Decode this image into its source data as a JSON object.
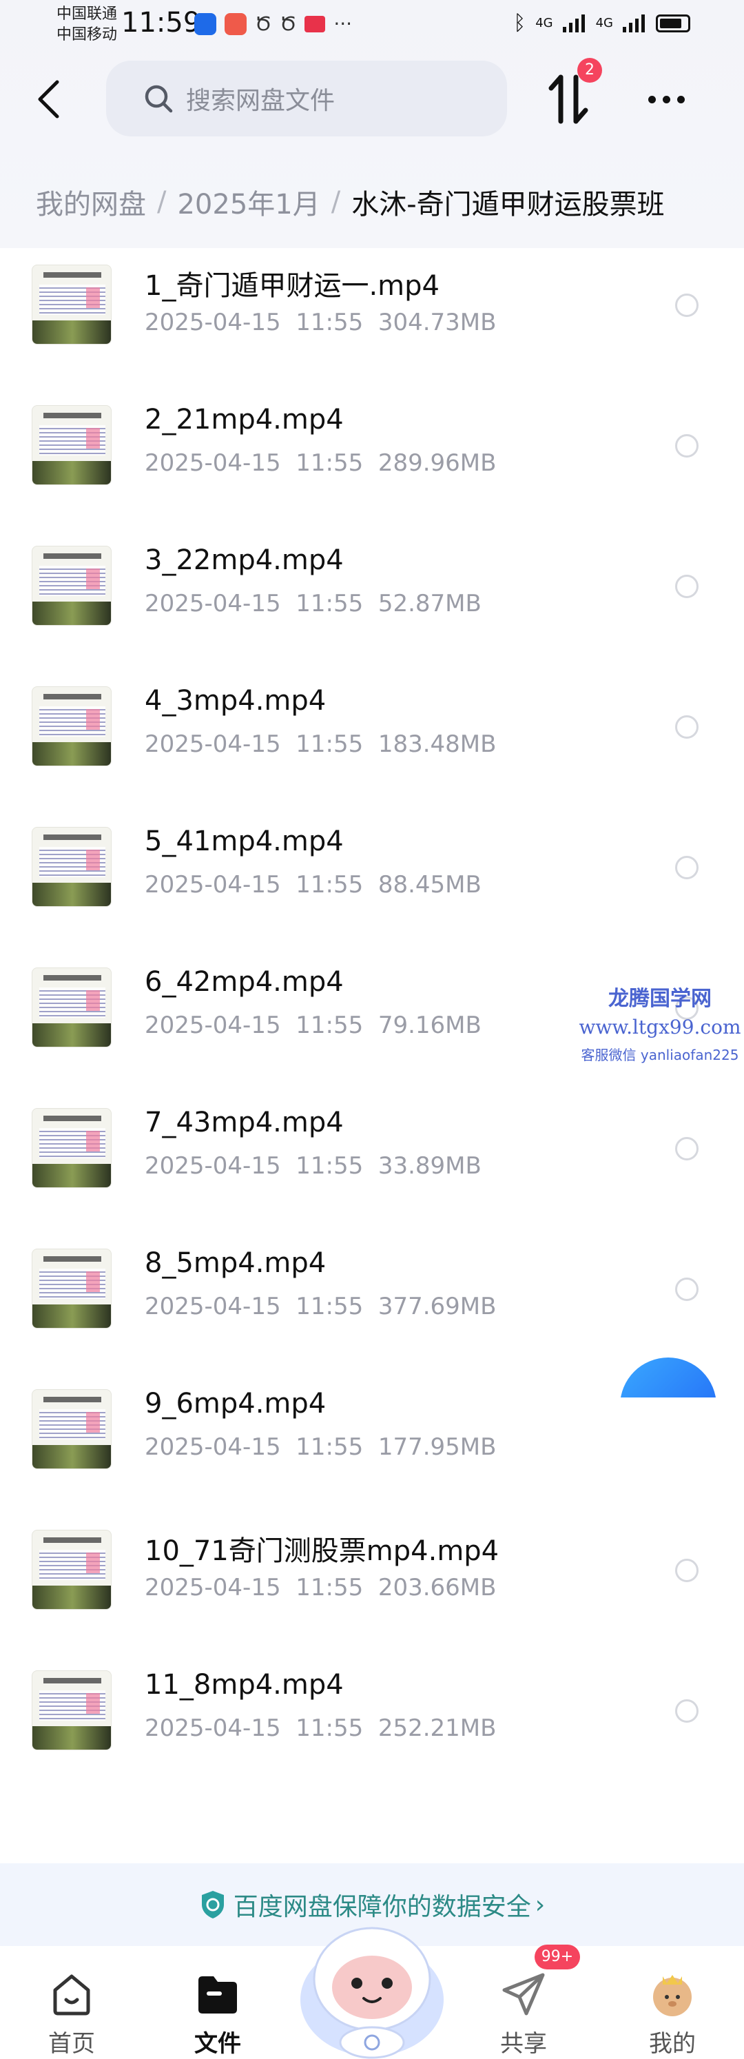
{
  "status_bar": {
    "carrier_1": "中国联通",
    "carrier_2": "中国移动",
    "time": "11:59",
    "net_1": "4G",
    "net_2": "4G"
  },
  "header": {
    "search_placeholder": "搜索网盘文件",
    "transfer_badge": "2"
  },
  "breadcrumb": {
    "root": "我的网盘",
    "middle": "2025年1月",
    "current": "水沐-奇门遁甲财运股票班"
  },
  "files": [
    {
      "name": "1_奇门遁甲财运一.mp4",
      "date": "2025-04-15",
      "time": "11:55",
      "size": "304.73MB"
    },
    {
      "name": "2_21mp4.mp4",
      "date": "2025-04-15",
      "time": "11:55",
      "size": "289.96MB"
    },
    {
      "name": "3_22mp4.mp4",
      "date": "2025-04-15",
      "time": "11:55",
      "size": "52.87MB"
    },
    {
      "name": "4_3mp4.mp4",
      "date": "2025-04-15",
      "time": "11:55",
      "size": "183.48MB"
    },
    {
      "name": "5_41mp4.mp4",
      "date": "2025-04-15",
      "time": "11:55",
      "size": "88.45MB"
    },
    {
      "name": "6_42mp4.mp4",
      "date": "2025-04-15",
      "time": "11:55",
      "size": "79.16MB"
    },
    {
      "name": "7_43mp4.mp4",
      "date": "2025-04-15",
      "time": "11:55",
      "size": "33.89MB"
    },
    {
      "name": "8_5mp4.mp4",
      "date": "2025-04-15",
      "time": "11:55",
      "size": "377.69MB"
    },
    {
      "name": "9_6mp4.mp4",
      "date": "2025-04-15",
      "time": "11:55",
      "size": "177.95MB"
    },
    {
      "name": "10_71奇门测股票mp4.mp4",
      "date": "2025-04-15",
      "time": "11:55",
      "size": "203.66MB"
    },
    {
      "name": "11_8mp4.mp4",
      "date": "2025-04-15",
      "time": "11:55",
      "size": "252.21MB"
    }
  ],
  "watermark": {
    "line1": "龙腾国学网",
    "line2": "www.ltgx99.com",
    "line3": "客服微信 yanliaofan225"
  },
  "security_banner": {
    "text": "百度网盘保障你的数据安全",
    "arrow": "›"
  },
  "nav": {
    "home": "首页",
    "files": "文件",
    "share": "共享",
    "share_badge": "99+",
    "mine": "我的"
  },
  "colors": {
    "accent_blue": "#1f63f5",
    "badge_red": "#f5445e",
    "security_teal": "#2c8a86"
  }
}
